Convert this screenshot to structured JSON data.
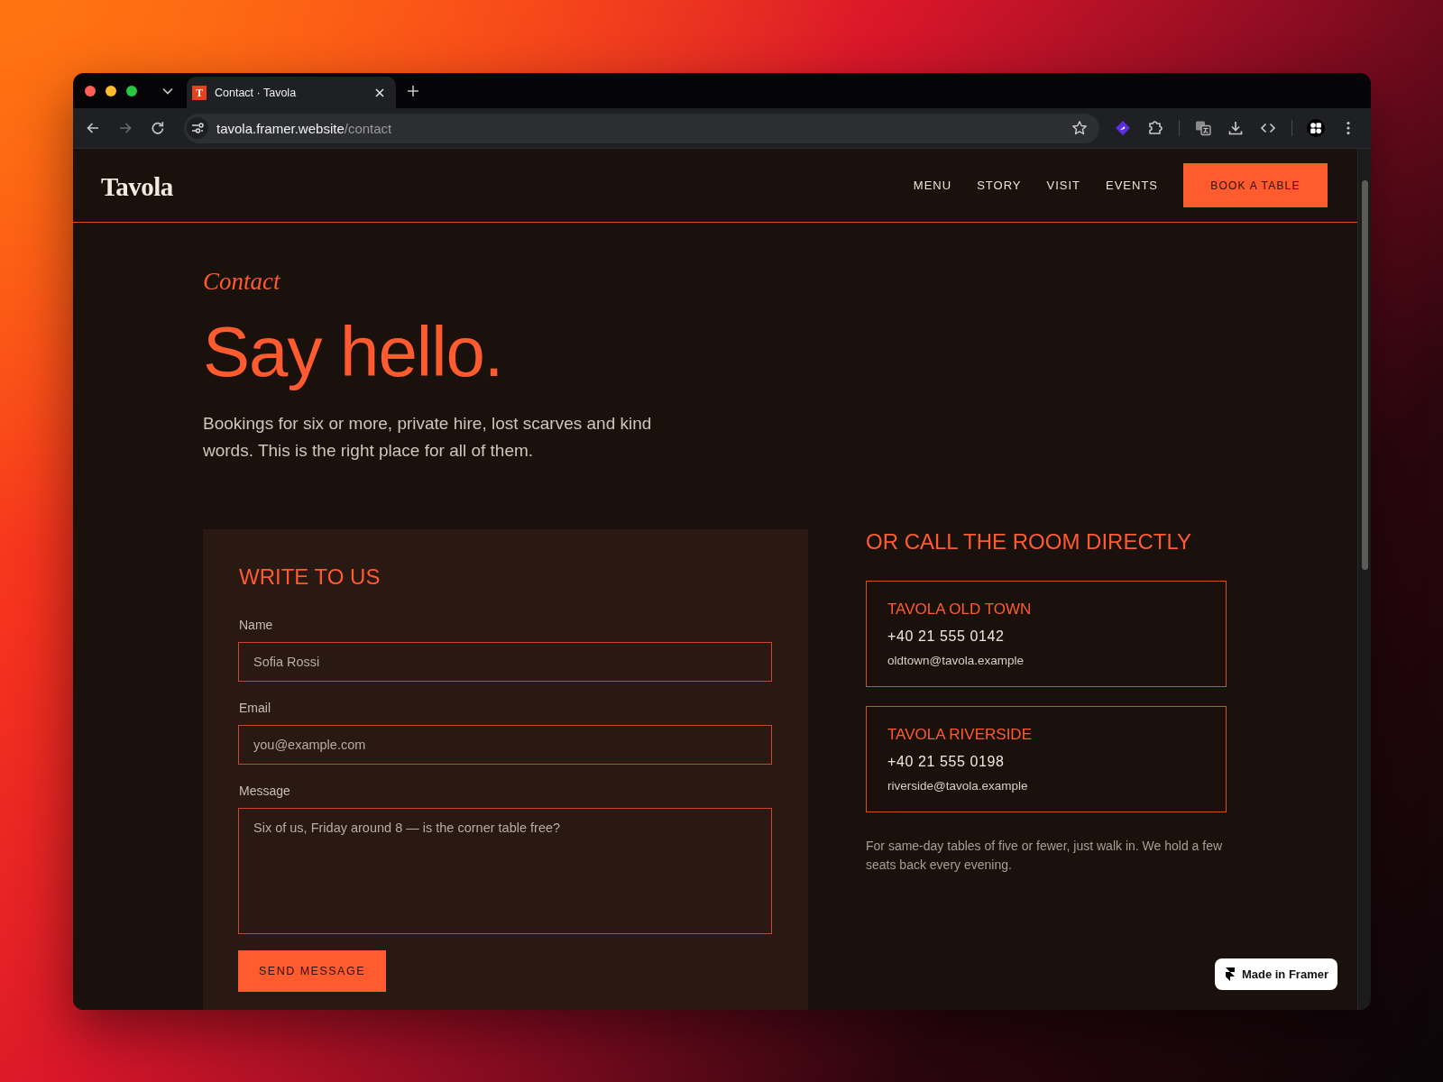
{
  "browser": {
    "tabs": [
      {
        "favicon": "T",
        "title": "Contact · Tavola",
        "selected": true
      }
    ],
    "address_bar": {
      "host": "tavola.framer.website",
      "path": "/contact"
    }
  },
  "site_header": {
    "logo": "Tavola",
    "nav": [
      {
        "label": "MENU"
      },
      {
        "label": "STORY"
      },
      {
        "label": "VISIT"
      },
      {
        "label": "EVENTS"
      }
    ],
    "cta_button": "BOOK A TABLE"
  },
  "hero": {
    "eyebrow": "Contact",
    "title": "Say hello.",
    "intro": "Bookings for six or more, private hire, lost scarves and kind words. This is the right place for all of them."
  },
  "contact_form": {
    "title": "WRITE TO US",
    "fields": [
      {
        "kind": "input",
        "label": "Name",
        "placeholder": "Sofia Rossi"
      },
      {
        "kind": "input",
        "label": "Email",
        "placeholder": "you@example.com"
      },
      {
        "kind": "textarea",
        "label": "Message",
        "placeholder": "Six of us, Friday around 8 — is the corner table free?"
      }
    ],
    "submit_button": "SEND MESSAGE"
  },
  "locations": {
    "title": "OR CALL THE ROOM DIRECTLY",
    "cards": [
      {
        "name": "TAVOLA OLD TOWN",
        "phone": "+40 21 555 0142",
        "email": "oldtown@tavola.example"
      },
      {
        "name": "TAVOLA RIVERSIDE",
        "phone": "+40 21 555 0198",
        "email": "riverside@tavola.example"
      }
    ],
    "note": "For same-day tables of five or fewer, just walk in. We hold a few seats back every evening."
  },
  "badge": {
    "label": "Made in Framer"
  }
}
